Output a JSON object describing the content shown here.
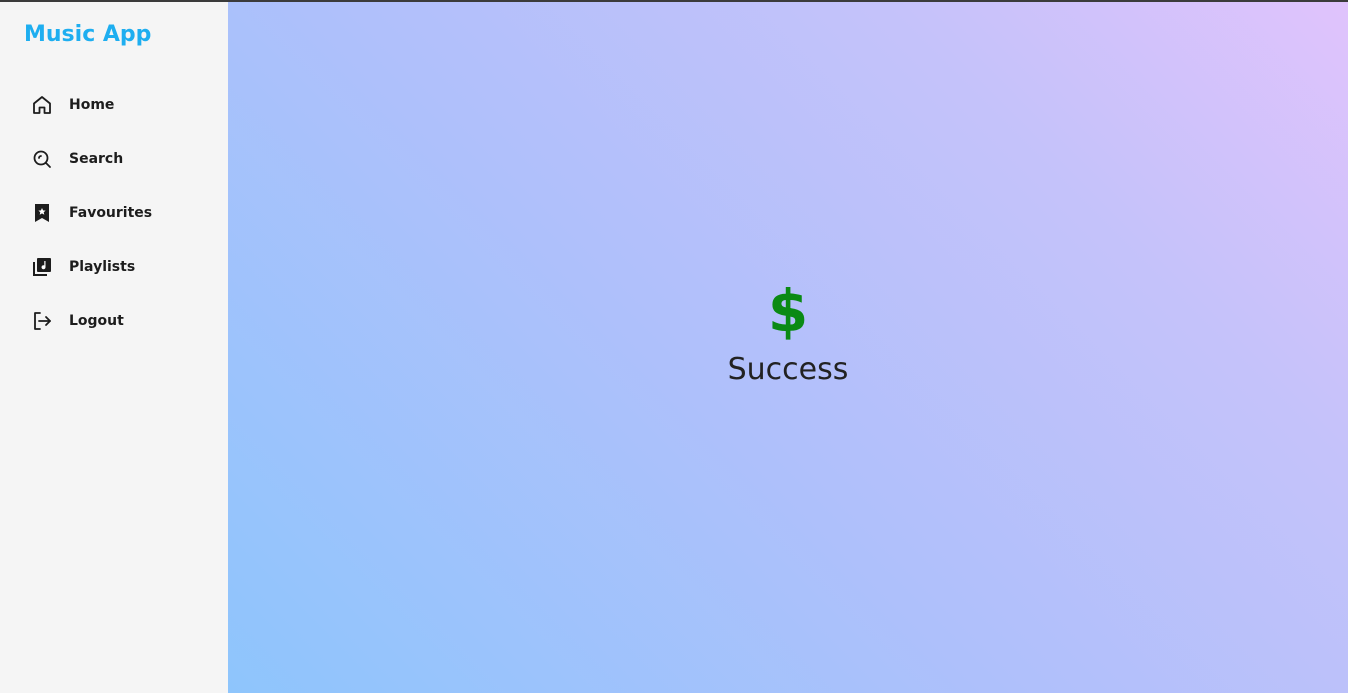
{
  "app": {
    "brand": "Music App",
    "brand_color": "#1eaef0"
  },
  "sidebar": {
    "items": [
      {
        "label": "Home",
        "icon": "home-icon"
      },
      {
        "label": "Search",
        "icon": "search-icon"
      },
      {
        "label": "Favourites",
        "icon": "bookmark-star-icon"
      },
      {
        "label": "Playlists",
        "icon": "library-music-icon"
      },
      {
        "label": "Logout",
        "icon": "logout-icon"
      }
    ]
  },
  "main": {
    "status_icon": "dollar-icon",
    "status_symbol": "$",
    "status_color": "#0a8a14",
    "status_text": "Success"
  }
}
